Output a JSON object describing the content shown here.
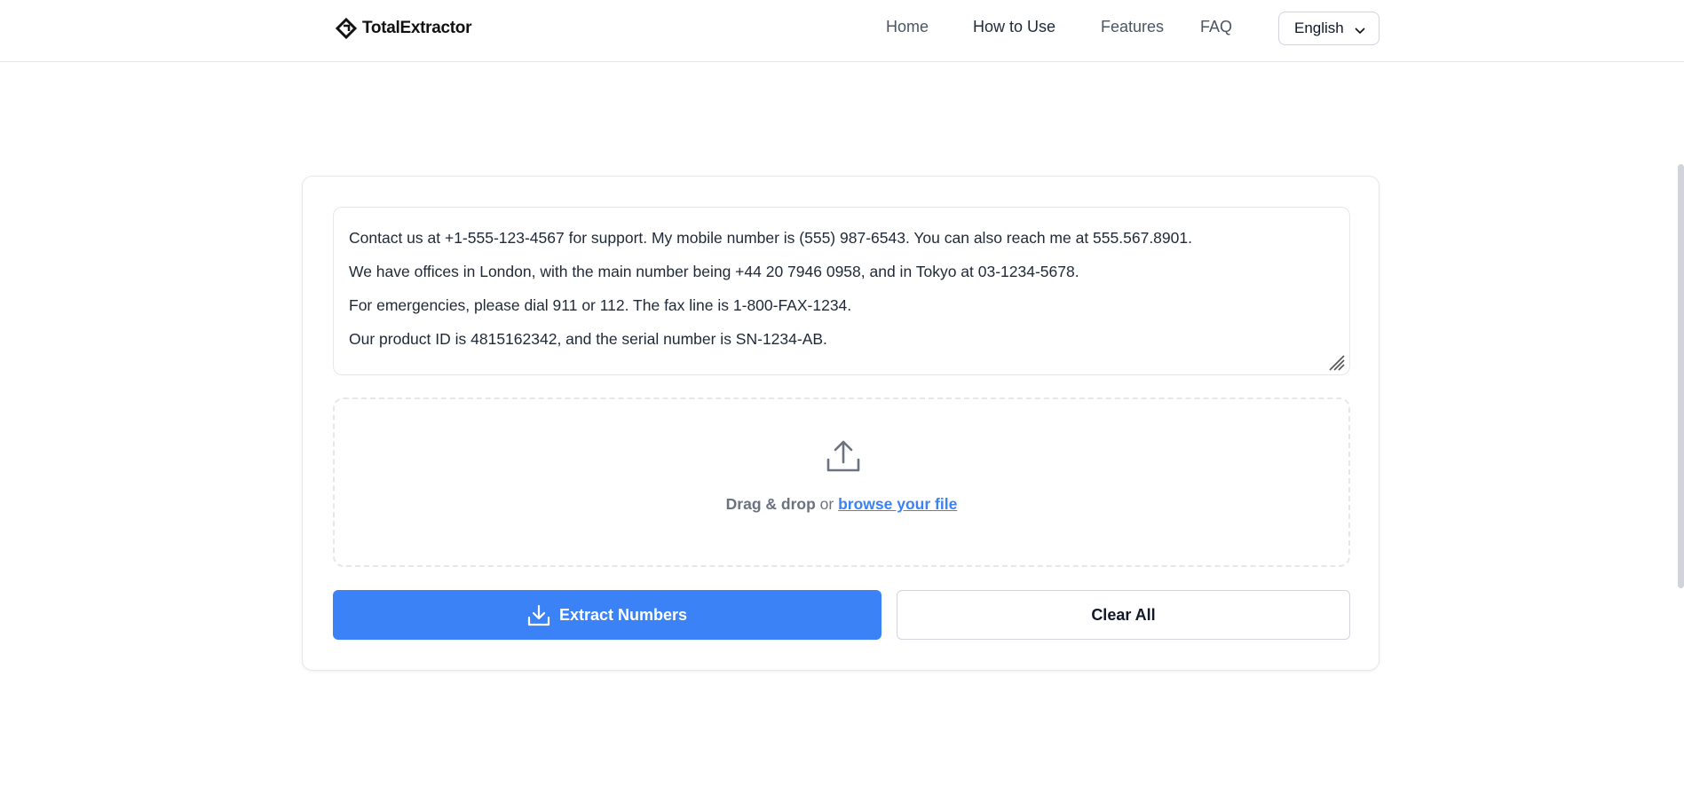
{
  "header": {
    "logo_text": "TotalExtractor",
    "nav": [
      {
        "label": "Home"
      },
      {
        "label": "How to Use"
      },
      {
        "label": "Features"
      },
      {
        "label": "FAQ"
      }
    ],
    "language": "English"
  },
  "input": {
    "lines": [
      "Contact us at +1-555-123-4567 for support. My mobile number is (555) 987-6543. You can also reach me at 555.567.8901.",
      "We have offices in London, with the main number being +44 20 7946 0958, and in Tokyo at 03-1234-5678.",
      "For emergencies, please dial 911 or 112. The fax line is 1-800-FAX-1234.",
      "Our product ID is 4815162342, and the serial number is SN-1234-AB."
    ]
  },
  "dropzone": {
    "drag_text": "Drag & drop",
    "or_text": "or",
    "browse_text": "browse your file"
  },
  "actions": {
    "extract_label": "Extract Numbers",
    "clear_label": "Clear All"
  },
  "colors": {
    "primary": "#3b82f6",
    "border": "#e5e7eb",
    "text": "#1f2937",
    "muted": "#6b7280"
  }
}
